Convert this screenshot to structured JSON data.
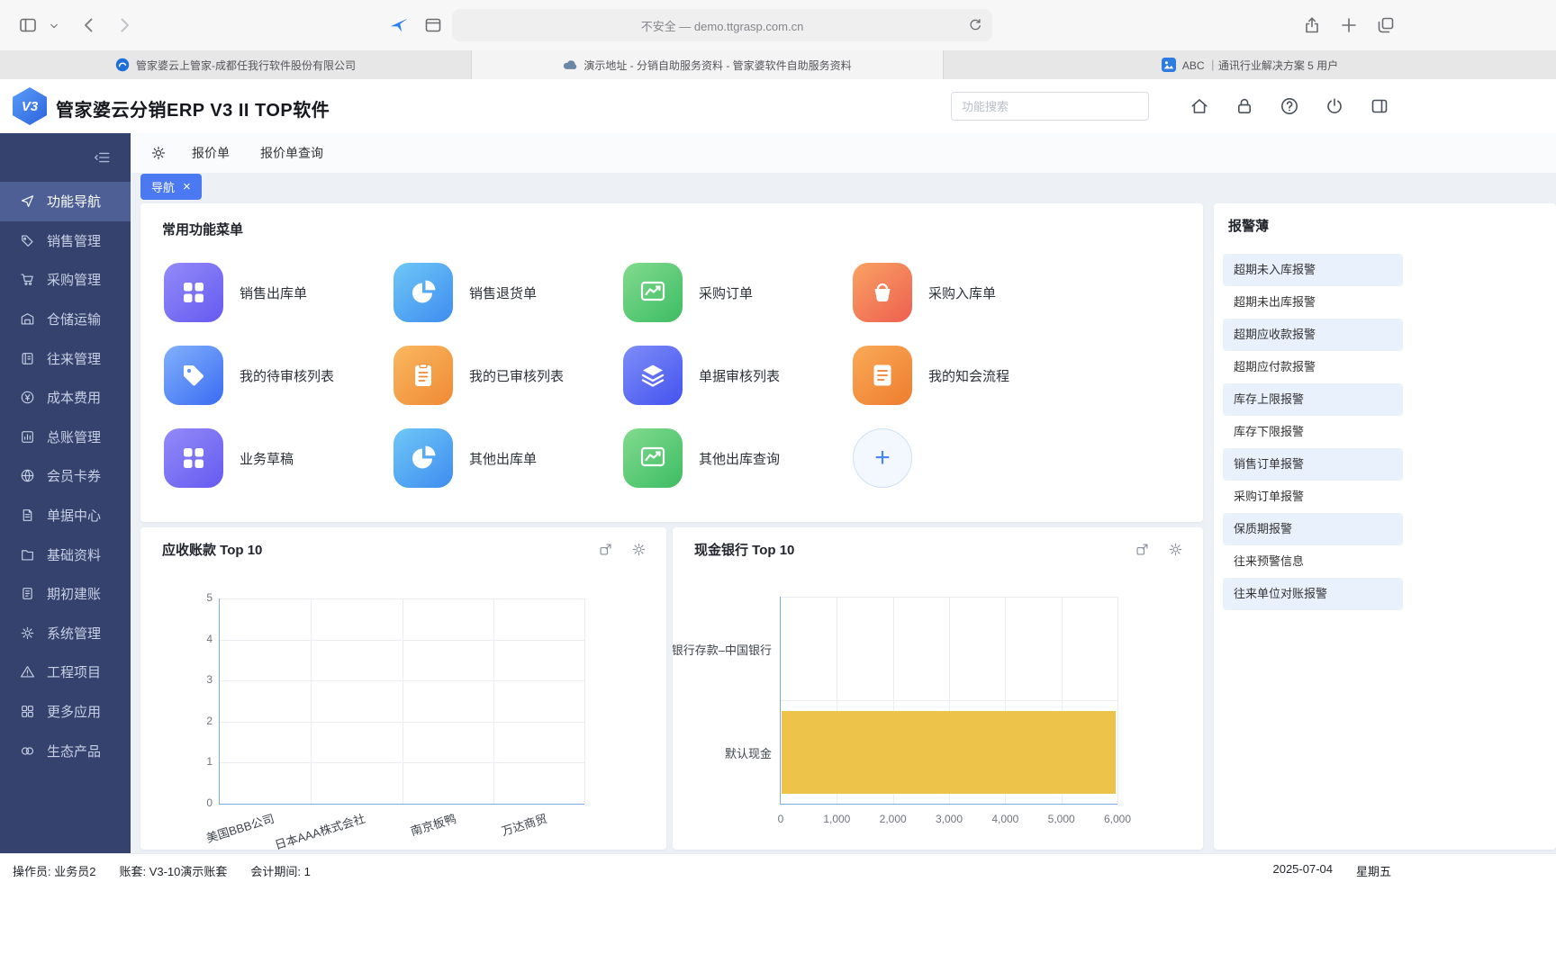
{
  "browser": {
    "toolbar": {
      "url_text": "不安全 — demo.ttgrasp.com.cn"
    },
    "tabs": [
      {
        "label": "管家婆云上管家-成都任我行软件股份有限公司",
        "icon": "grasp-favicon",
        "active": false
      },
      {
        "label": "演示地址 - 分销自助服务资料 - 管家婆软件自助服务资料",
        "icon": "cloud-favicon",
        "active": true
      },
      {
        "label": "ABC ｜通讯行业解决方案 5 用户",
        "icon": "abc-favicon",
        "active": false
      }
    ]
  },
  "header": {
    "logo_text": "V3",
    "app_title": "管家婆云分销ERP V3 II TOP软件",
    "search_placeholder": "功能搜索"
  },
  "sidebar": {
    "items": [
      {
        "label": "功能导航",
        "icon": "nav-icon",
        "active": true
      },
      {
        "label": "销售管理",
        "icon": "sales-tag-icon",
        "active": false
      },
      {
        "label": "采购管理",
        "icon": "cart-icon",
        "active": false
      },
      {
        "label": "仓储运输",
        "icon": "warehouse-icon",
        "active": false
      },
      {
        "label": "往来管理",
        "icon": "contacts-icon",
        "active": false
      },
      {
        "label": "成本费用",
        "icon": "cost-icon",
        "active": false
      },
      {
        "label": "总账管理",
        "icon": "ledger-icon",
        "active": false
      },
      {
        "label": "会员卡券",
        "icon": "member-icon",
        "active": false
      },
      {
        "label": "单据中心",
        "icon": "docs-icon",
        "active": false
      },
      {
        "label": "基础资料",
        "icon": "basedata-icon",
        "active": false
      },
      {
        "label": "期初建账",
        "icon": "init-icon",
        "active": false
      },
      {
        "label": "系统管理",
        "icon": "system-icon",
        "active": false
      },
      {
        "label": "工程项目",
        "icon": "project-icon",
        "active": false
      },
      {
        "label": "更多应用",
        "icon": "apps-icon",
        "active": false
      },
      {
        "label": "生态产品",
        "icon": "eco-icon",
        "active": false
      }
    ]
  },
  "quickbar": {
    "links": [
      "报价单",
      "报价单查询"
    ]
  },
  "workspace_tab": {
    "label": "导航",
    "close_glyph": "×"
  },
  "menu_card": {
    "title": "常用功能菜单",
    "plus_glyph": "+",
    "tiles": [
      {
        "label": "销售出库单",
        "icon": "grid",
        "colors": [
          "#938bf9",
          "#655af0"
        ]
      },
      {
        "label": "销售退货单",
        "icon": "pie",
        "colors": [
          "#6fc8f6",
          "#3e8cf1"
        ]
      },
      {
        "label": "采购订单",
        "icon": "trend",
        "colors": [
          "#82da8e",
          "#3dbd64"
        ]
      },
      {
        "label": "采购入库单",
        "icon": "bucket",
        "colors": [
          "#f9a263",
          "#ee5f50"
        ]
      },
      {
        "label": "我的待审核列表",
        "icon": "tag",
        "colors": [
          "#82b1fb",
          "#3a6cf3"
        ]
      },
      {
        "label": "我的已审核列表",
        "icon": "clipboard",
        "colors": [
          "#f9b860",
          "#f08a35"
        ]
      },
      {
        "label": "单据审核列表",
        "icon": "layers",
        "colors": [
          "#7e8ef8",
          "#4452ee"
        ]
      },
      {
        "label": "我的知会流程",
        "icon": "doc",
        "colors": [
          "#f9aa57",
          "#ee7d2f"
        ]
      },
      {
        "label": "业务草稿",
        "icon": "grid",
        "colors": [
          "#938bf9",
          "#655af0"
        ]
      },
      {
        "label": "其他出库单",
        "icon": "pie",
        "colors": [
          "#6fc8f6",
          "#3e8cf1"
        ]
      },
      {
        "label": "其他出库查询",
        "icon": "trend",
        "colors": [
          "#82da8e",
          "#3dbd64"
        ]
      },
      {
        "label": "",
        "icon": "plus",
        "type": "add",
        "colors": []
      }
    ]
  },
  "alarm_panel": {
    "title": "报警薄",
    "items": [
      {
        "label": "超期未入库报警",
        "highlighted": true
      },
      {
        "label": "超期未出库报警",
        "highlighted": false
      },
      {
        "label": "超期应收款报警",
        "highlighted": true
      },
      {
        "label": "超期应付款报警",
        "highlighted": false
      },
      {
        "label": "库存上限报警",
        "highlighted": true
      },
      {
        "label": "库存下限报警",
        "highlighted": false
      },
      {
        "label": "销售订单报警",
        "highlighted": true
      },
      {
        "label": "采购订单报警",
        "highlighted": false
      },
      {
        "label": "保质期报警",
        "highlighted": true
      },
      {
        "label": "往来预警信息",
        "highlighted": false
      },
      {
        "label": "往来单位对账报警",
        "highlighted": true
      }
    ]
  },
  "chart_data": [
    {
      "type": "bar",
      "title": "应收账款 Top 10",
      "categories": [
        "美国BBB公司",
        "日本AAA株式会社",
        "南京板鸭",
        "万达商贸"
      ],
      "values": [
        0,
        0,
        0,
        0
      ],
      "ylim": [
        0,
        5
      ],
      "yticks": [
        0,
        1,
        2,
        3,
        4,
        5
      ],
      "grid": true,
      "legend": false,
      "axis_color": "#79abe5"
    },
    {
      "type": "bar-horizontal",
      "title": "现金银行 Top 10",
      "categories": [
        "银行存款–中国银行",
        "默认现金"
      ],
      "values": [
        0,
        5950
      ],
      "xlim": [
        0,
        6000
      ],
      "xtick_labels": [
        "0",
        "1,000",
        "2,000",
        "3,000",
        "4,000",
        "5,000",
        "6,000"
      ],
      "bar_color": "#eec349",
      "grid": true,
      "legend": false,
      "axis_color": "#79abe5"
    }
  ],
  "footer": {
    "operator": "操作员: 业务员2",
    "account": "账套: V3-10演示账套",
    "period": "会计期间: 1",
    "date": "2025-07-04",
    "weekday": "星期五"
  }
}
